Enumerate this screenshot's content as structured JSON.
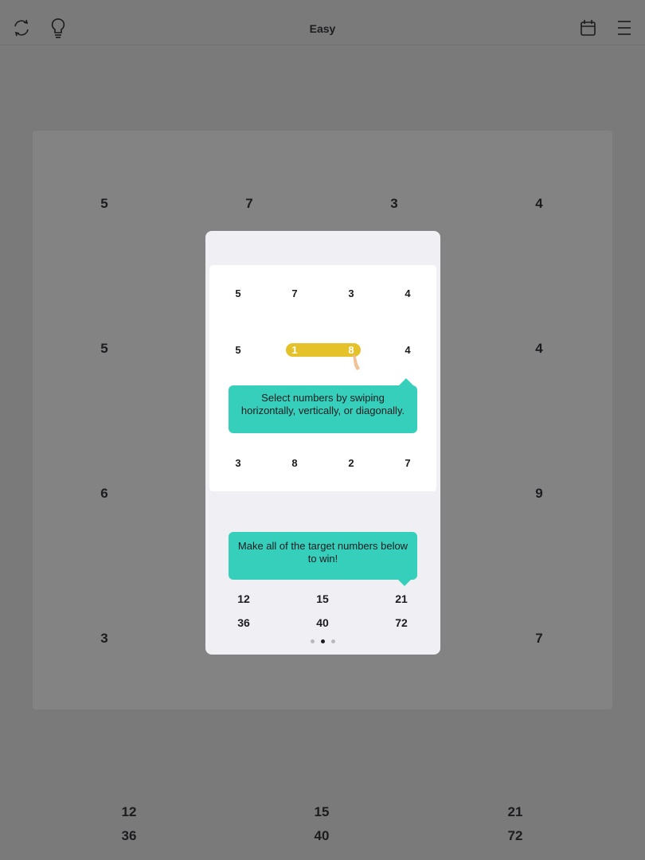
{
  "header": {
    "title": "Easy"
  },
  "icons": {
    "refresh": "refresh-icon",
    "hint": "lightbulb-icon",
    "calendar": "calendar-icon",
    "menu": "hamburger-menu-icon",
    "finger": "finger-pointer-icon"
  },
  "board": {
    "cells": [
      "5",
      "7",
      "3",
      "4",
      "5",
      "4",
      "6",
      "9",
      "3",
      "7"
    ]
  },
  "targets": [
    "12",
    "15",
    "21",
    "36",
    "40",
    "72"
  ],
  "tutorial": {
    "grid": [
      "5",
      "7",
      "3",
      "4",
      "5",
      "4",
      "3",
      "8",
      "2",
      "7"
    ],
    "selection": [
      "1",
      "8"
    ],
    "tip_select": "Select numbers by swiping horizontally, vertically, or diagonally.",
    "tip_targets": "Make all of the target numbers below to win!",
    "targets": [
      "12",
      "15",
      "21",
      "36",
      "40",
      "72"
    ],
    "page_index": 2,
    "page_count": 3
  },
  "colors": {
    "accent": "#35cfbb",
    "selection": "#e6c22a",
    "overlay": "#7a7a7b"
  }
}
